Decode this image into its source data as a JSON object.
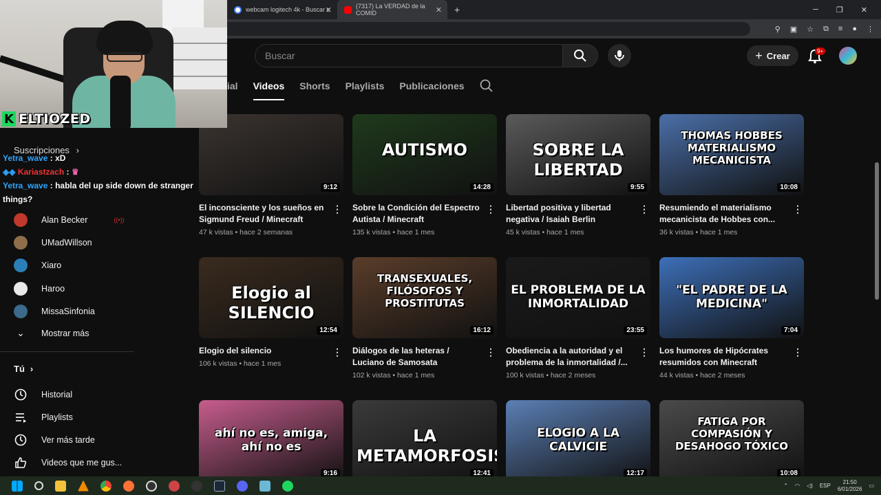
{
  "browser": {
    "tabs": [
      {
        "label": "webcam logitech 4k - Buscar c",
        "icon": "google-icon"
      },
      {
        "label": "(7317) La VERDAD de la COMID",
        "icon": "youtube-icon"
      }
    ]
  },
  "header": {
    "search_placeholder": "Buscar",
    "create_label": "Crear",
    "notif_count": "9+"
  },
  "channel_tabs": [
    {
      "label": "ial",
      "active": false
    },
    {
      "label": "Videos",
      "active": true
    },
    {
      "label": "Shorts",
      "active": false
    },
    {
      "label": "Playlists",
      "active": false
    },
    {
      "label": "Publicaciones",
      "active": false
    }
  ],
  "videos": [
    {
      "title": "El inconsciente y los sueños en Sigmund Freud / Minecraft",
      "views": "47 k vistas",
      "age": "hace 2 semanas",
      "duration": "9:12",
      "thumb_text": "",
      "bg": "#3b3430"
    },
    {
      "title": "Sobre la Condición del Espectro Autista / Minecraft",
      "views": "135 k vistas",
      "age": "hace 1 mes",
      "duration": "14:28",
      "thumb_text": "AUTISMO",
      "bg": "#1f3a1c"
    },
    {
      "title": "Libertad positiva y libertad negativa / Isaiah Berlin",
      "views": "45 k vistas",
      "age": "hace 1 mes",
      "duration": "9:55",
      "thumb_text": "SOBRE LA LIBERTAD",
      "bg": "#5a5a5a"
    },
    {
      "title": "Resumiendo el materialismo mecanicista de Hobbes con...",
      "views": "36 k vistas",
      "age": "hace 1 mes",
      "duration": "10:08",
      "thumb_text": "THOMAS HOBBES MATERIALISMO MECANICISTA",
      "bg": "#4a6fa8"
    },
    {
      "title": "Elogio del silencio",
      "views": "106 k vistas",
      "age": "hace 1 mes",
      "duration": "12:54",
      "thumb_text": "Elogio al SILENCIO",
      "bg": "#3a2b1e"
    },
    {
      "title": "Diálogos de las heteras / Luciano de Samosata",
      "views": "102 k vistas",
      "age": "hace 1 mes",
      "duration": "16:12",
      "thumb_text": "TRANSEXUALES, FILÓSOFOS Y PROSTITUTAS",
      "bg": "#5a3d2a"
    },
    {
      "title": "Obediencia a la autoridad y el problema de la inmortalidad /...",
      "views": "100 k vistas",
      "age": "hace 2 meses",
      "duration": "23:55",
      "thumb_text": "EL PROBLEMA DE LA INMORTALIDAD",
      "bg": "#1a1a1a"
    },
    {
      "title": "Los humores de Hipócrates resumidos con Minecraft",
      "views": "44 k vistas",
      "age": "hace 2 meses",
      "duration": "7:04",
      "thumb_text": "\"EL PADRE DE LA MEDICINA\"",
      "bg": "#3d6fb8"
    },
    {
      "title": "",
      "views": "",
      "age": "",
      "duration": "9:16",
      "thumb_text": "ahí no es, amiga, ahí no es",
      "bg": "#c75d8d"
    },
    {
      "title": "",
      "views": "",
      "age": "",
      "duration": "12:41",
      "thumb_text": "LA METAMORFOSIS",
      "bg": "#3a3a3a"
    },
    {
      "title": "",
      "views": "",
      "age": "",
      "duration": "12:17",
      "thumb_text": "ELOGIO A LA CALVICIE",
      "bg": "#5b7fb5"
    },
    {
      "title": "",
      "views": "",
      "age": "",
      "duration": "10:08",
      "thumb_text": "FATIGA POR COMPASIÓN Y DESAHOGO TÓXICO",
      "bg": "#4a4a4a"
    }
  ],
  "sidebar": {
    "subs_heading": "Suscripciones",
    "channels": [
      {
        "name": "Alan Becker",
        "color": "#c0392b",
        "live": true
      },
      {
        "name": "UMadWillson",
        "color": "#8e6f4a",
        "live": false
      },
      {
        "name": "Xiaro",
        "color": "#2a7fb8",
        "live": false
      },
      {
        "name": "Haroo",
        "color": "#e8e8e8",
        "live": false
      },
      {
        "name": "MissaSinfonia",
        "color": "#3b6a8a",
        "live": false
      }
    ],
    "show_more": "Mostrar más",
    "you_heading": "Tú",
    "you_items": [
      {
        "label": "Historial",
        "icon": "history-icon"
      },
      {
        "label": "Playlists",
        "icon": "playlists-icon"
      },
      {
        "label": "Ver más tarde",
        "icon": "clock-icon"
      },
      {
        "label": "Videos que me gus...",
        "icon": "like-icon"
      }
    ]
  },
  "webcam": {
    "streamer_name": "ELTIOZED",
    "logo_letter": "K"
  },
  "chat": [
    {
      "user": "Yetra_wave",
      "text": ": xD"
    },
    {
      "user": "Kariastzach",
      "text": ":"
    },
    {
      "user": "Yetra_wave",
      "text": ": habla del up side down de stranger things?"
    }
  ],
  "taskbar": {
    "lang": "ESP",
    "time": "21:50",
    "date": "6/01/2026"
  }
}
